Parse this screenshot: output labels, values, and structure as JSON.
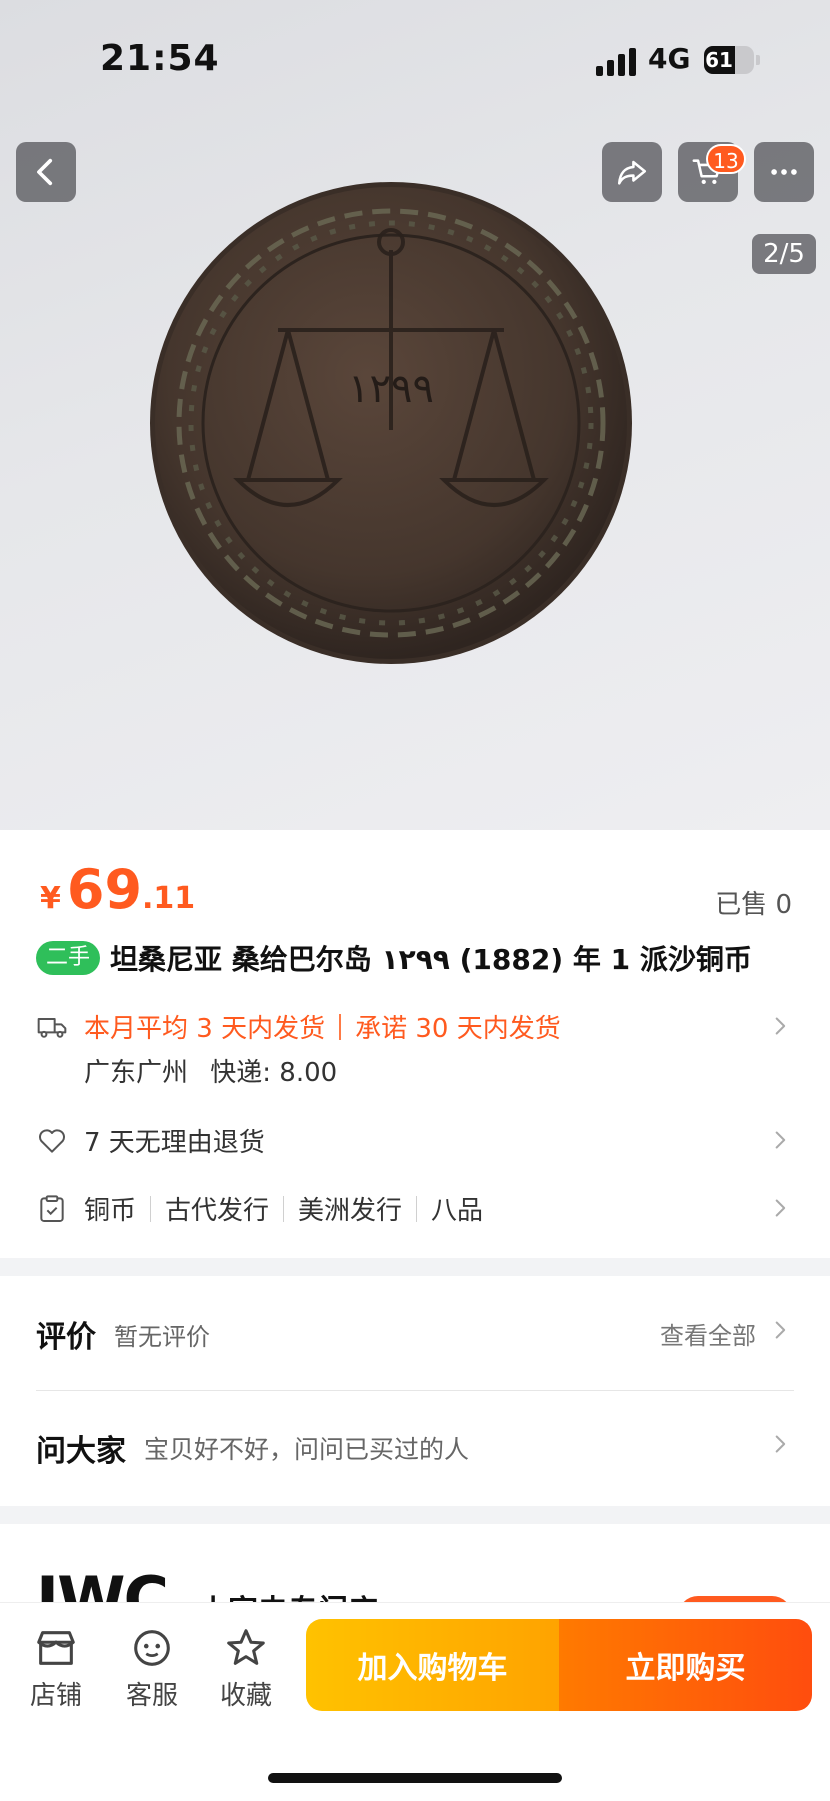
{
  "status_bar": {
    "time": "21:54",
    "network": "4G",
    "battery": "61",
    "battery_level": 0.61
  },
  "gallery": {
    "counter": "2/5",
    "cart_count": "13",
    "coin_date": "١٢٩٩"
  },
  "price": {
    "currency": "¥",
    "integer": "69",
    "decimal": ".11",
    "sold": "已售 0"
  },
  "product": {
    "tag": "二手",
    "title": "坦桑尼亚 桑给巴尔岛 ١٢٩٩ (1882) 年 1 派沙铜币"
  },
  "shipping": {
    "avg": "本月平均 3 天内发货",
    "promise": "承诺 30 天内发货",
    "location": "广东广州",
    "express": "快递: 8.00"
  },
  "returns": {
    "label": "7 天无理由退货"
  },
  "attributes": [
    "铜币",
    "古代发行",
    "美洲发行",
    "八品"
  ],
  "reviews": {
    "title": "评价",
    "status": "暂无评价",
    "view_all": "查看全部"
  },
  "ask": {
    "title": "问大家",
    "prompt": "宝贝好不好，问问已买过的人"
  },
  "store": {
    "logo_text": "IWC",
    "name": "小家电专门店"
  },
  "bottom_bar": {
    "tabs": [
      "店铺",
      "客服",
      "收藏"
    ],
    "add_cart": "加入购物车",
    "buy_now": "立即购买"
  },
  "colors": {
    "accent": "#ff5a1f",
    "tag_green": "#2fbf5a",
    "cart_yellow": "#ffc200"
  }
}
